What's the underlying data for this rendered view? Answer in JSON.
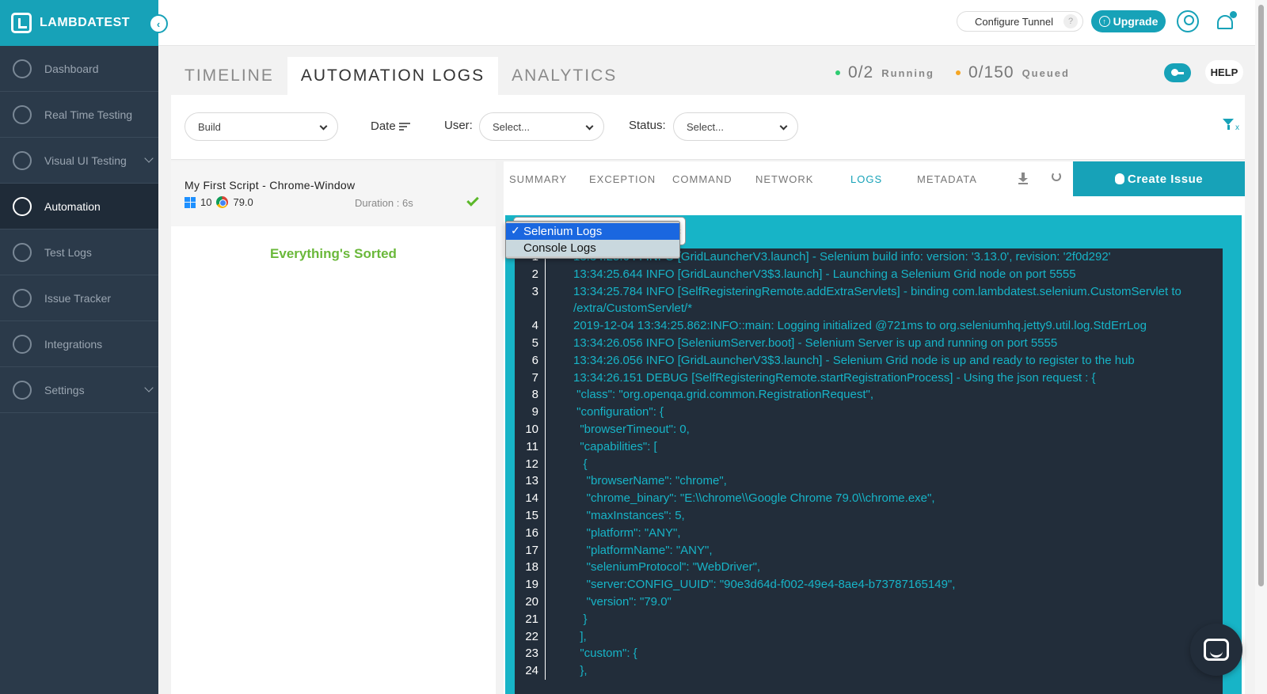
{
  "brand": {
    "name": "LAMBDATEST",
    "collapse_glyph": "‹"
  },
  "sidebar": {
    "items": [
      {
        "label": "Dashboard",
        "icon": "dashboard-icon",
        "active": false
      },
      {
        "label": "Real Time Testing",
        "icon": "clock-icon",
        "active": false
      },
      {
        "label": "Visual UI Testing",
        "icon": "eye-icon",
        "active": false,
        "expandable": true
      },
      {
        "label": "Automation",
        "icon": "robot-icon",
        "active": true
      },
      {
        "label": "Test Logs",
        "icon": "cube-icon",
        "active": false
      },
      {
        "label": "Issue Tracker",
        "icon": "bug-icon",
        "active": false
      },
      {
        "label": "Integrations",
        "icon": "puzzle-icon",
        "active": false
      },
      {
        "label": "Settings",
        "icon": "gear-icon",
        "active": false,
        "expandable": true
      }
    ]
  },
  "header": {
    "configure_tunnel": "Configure Tunnel",
    "tunnel_help": "?",
    "upgrade": "Upgrade"
  },
  "tabs": {
    "timeline": "TIMELINE",
    "automation_logs": "AUTOMATION LOGS",
    "analytics": "ANALYTICS"
  },
  "stats": {
    "running_value": "0/2",
    "running_label": "Running",
    "running_color": "#2ecc71",
    "queued_value": "0/150",
    "queued_label": "Queued",
    "queued_color": "#f5a623"
  },
  "help_label": "HELP",
  "filters": {
    "build": "Build",
    "date_label": "Date",
    "user_label": "User:",
    "user_value": "Select...",
    "status_label": "Status:",
    "status_value": "Select...",
    "clear_x": "x"
  },
  "test": {
    "title": "My First Script - Chrome-Window",
    "os_version": "10",
    "browser_version": "79.0",
    "duration": "Duration : 6s",
    "empty_message": "Everything's Sorted"
  },
  "detail_tabs": {
    "summary": "SUMMARY",
    "exception": "EXCEPTION",
    "command": "COMMAND",
    "network": "NETWORK",
    "logs": "LOGS",
    "metadata": "METADATA",
    "create_issue": "Create Issue"
  },
  "log_type": {
    "options": [
      "Selenium Logs",
      "Console Logs"
    ],
    "selected": "Selenium Logs",
    "tick": "✓"
  },
  "log_lines": [
    {
      "n": "1",
      "t": "13:34:25.644 INFO [GridLauncherV3.launch] - Selenium build info: version: '3.13.0', revision: '2f0d292'"
    },
    {
      "n": "2",
      "t": "13:34:25.644 INFO [GridLauncherV3$3.launch] - Launching a Selenium Grid node on port 5555"
    },
    {
      "n": "3",
      "t": "13:34:25.784 INFO [SelfRegisteringRemote.addExtraServlets] - binding com.lambdatest.selenium.CustomServlet to /extra/CustomServlet/*"
    },
    {
      "n": "4",
      "t": "2019-12-04 13:34:25.862:INFO::main: Logging initialized @721ms to org.seleniumhq.jetty9.util.log.StdErrLog"
    },
    {
      "n": "5",
      "t": "13:34:26.056 INFO [SeleniumServer.boot] - Selenium Server is up and running on port 5555"
    },
    {
      "n": "6",
      "t": "13:34:26.056 INFO [GridLauncherV3$3.launch] - Selenium Grid node is up and ready to register to the hub"
    },
    {
      "n": "7",
      "t": "13:34:26.151 DEBUG [SelfRegisteringRemote.startRegistrationProcess] - Using the json request : {"
    },
    {
      "n": "8",
      "t": " \"class\": \"org.openqa.grid.common.RegistrationRequest\","
    },
    {
      "n": "9",
      "t": " \"configuration\": {"
    },
    {
      "n": "10",
      "t": "  \"browserTimeout\": 0,"
    },
    {
      "n": "11",
      "t": "  \"capabilities\": ["
    },
    {
      "n": "12",
      "t": "   {"
    },
    {
      "n": "13",
      "t": "    \"browserName\": \"chrome\","
    },
    {
      "n": "14",
      "t": "    \"chrome_binary\": \"E:\\\\chrome\\\\Google Chrome 79.0\\\\chrome.exe\","
    },
    {
      "n": "15",
      "t": "    \"maxInstances\": 5,"
    },
    {
      "n": "16",
      "t": "    \"platform\": \"ANY\","
    },
    {
      "n": "17",
      "t": "    \"platformName\": \"ANY\","
    },
    {
      "n": "18",
      "t": "    \"seleniumProtocol\": \"WebDriver\","
    },
    {
      "n": "19",
      "t": "    \"server:CONFIG_UUID\": \"90e3d64d-f002-49e4-8ae4-b73787165149\","
    },
    {
      "n": "20",
      "t": "    \"version\": \"79.0\""
    },
    {
      "n": "21",
      "t": "   }"
    },
    {
      "n": "22",
      "t": "  ],"
    },
    {
      "n": "23",
      "t": "  \"custom\": {"
    },
    {
      "n": "24",
      "t": "  },"
    }
  ]
}
